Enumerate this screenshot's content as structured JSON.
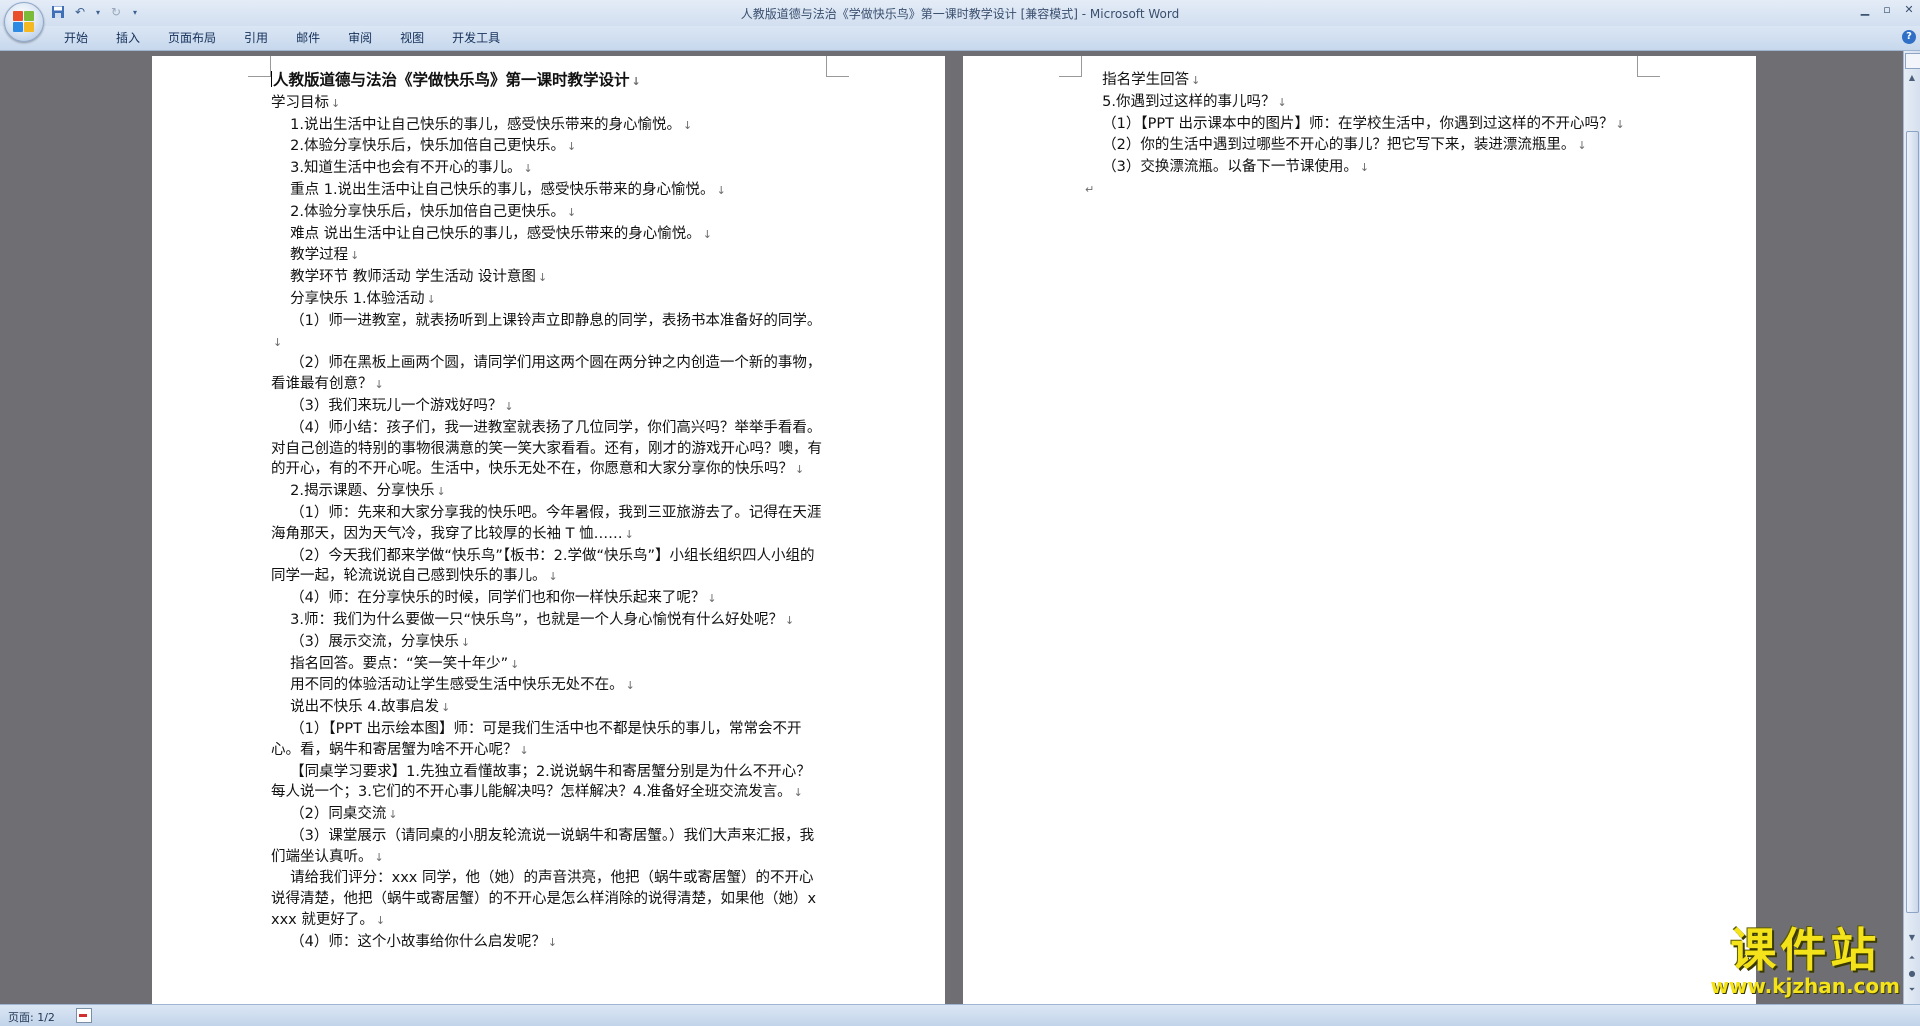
{
  "window": {
    "title": "人教版道德与法治《学做快乐鸟》第一课时教学设计 [兼容模式] - Microsoft Word"
  },
  "ribbon": {
    "tabs": [
      "开始",
      "插入",
      "页面布局",
      "引用",
      "邮件",
      "审阅",
      "视图",
      "开发工具"
    ]
  },
  "page1": {
    "paragraphs": [
      "人教版道德与法治《学做快乐鸟》第一课时教学设计",
      "学习目标",
      "　 1.说出生活中让自己快乐的事儿，感受快乐带来的身心愉悦。",
      "　 2.体验分享快乐后，快乐加倍自己更快乐。",
      "　 3.知道生活中也会有不开心的事儿。",
      "　 重点 1.说出生活中让自己快乐的事儿，感受快乐带来的身心愉悦。",
      "　 2.体验分享快乐后，快乐加倍自己更快乐。",
      "　 难点 说出生活中让自己快乐的事儿，感受快乐带来的身心愉悦。",
      "　 教学过程",
      "　 教学环节 教师活动 学生活动 设计意图",
      "　 分享快乐 1.体验活动",
      "　 （1）师一进教室，就表扬听到上课铃声立即静息的同学，表扬书本准备好的同学。",
      "　 （2）师在黑板上画两个圆，请同学们用这两个圆在两分钟之内创造一个新的事物，看谁最有创意？",
      "　 （3）我们来玩儿一个游戏好吗？",
      "　 （4）师小结：孩子们，我一进教室就表扬了几位同学，你们高兴吗？举举手看看。对自己创造的特别的事物很满意的笑一笑大家看看。还有，刚才的游戏开心吗？噢，有的开心，有的不开心呢。生活中，快乐无处不在，你愿意和大家分享你的快乐吗？",
      "　 2.揭示课题、分享快乐",
      "　 （1）师：先来和大家分享我的快乐吧。今年暑假，我到三亚旅游去了。记得在天涯海角那天，因为天气冷，我穿了比较厚的长袖 T 恤……",
      "　 （2）今天我们都来学做“快乐鸟”【板书：2.学做“快乐鸟”】小组长组织四人小组的同学一起，轮流说说自己感到快乐的事儿。",
      "　 （4）师：在分享快乐的时候，同学们也和你一样快乐起来了呢？",
      "　 3.师：我们为什么要做一只“快乐鸟”，也就是一个人身心愉悦有什么好处呢？",
      "　 （3）展示交流，分享快乐",
      "　 指名回答。要点：“笑一笑十年少”",
      "　 用不同的体验活动让学生感受生活中快乐无处不在。",
      "　 说出不快乐 4.故事启发",
      "　 （1）【PPT 出示绘本图】师：可是我们生活中也不都是快乐的事儿，常常会不开心。看，蜗牛和寄居蟹为啥不开心呢？",
      "　 【同桌学习要求】1.先独立看懂故事；2.说说蜗牛和寄居蟹分别是为什么不开心？每人说一个；3.它们的不开心事儿能解决吗？怎样解决？4.准备好全班交流发言。",
      "　 （2）同桌交流",
      "　 （3）课堂展示（请同桌的小朋友轮流说一说蜗牛和寄居蟹。）我们大声来汇报，我们端坐认真听。",
      "　 请给我们评分：xxx 同学，他（她）的声音洪亮，他把（蜗牛或寄居蟹）的不开心说得清楚，他把（蜗牛或寄居蟹）的不开心是怎么样消除的说得清楚，如果他（她）xxxx 就更好了。",
      "　 （4）师：这个小故事给你什么启发呢？"
    ]
  },
  "page2": {
    "paragraphs": [
      "　 指名学生回答",
      "　 5.你遇到过这样的事儿吗？",
      "　 （1）【PPT 出示课本中的图片】师：在学校生活中，你遇到过这样的不开心吗？",
      "　 （2）你的生活中遇到过哪些不开心的事儿？把它写下来，装进漂流瓶里。",
      "　 （3）交换漂流瓶。以备下一节课使用。"
    ]
  },
  "statusbar": {
    "page_indicator": "页面: 1/2"
  },
  "watermark": {
    "main": "课件站",
    "url": "www.kjzhan.com"
  },
  "colors": {
    "workspace": "#6f6f73",
    "watermark": "#f4e21b"
  }
}
